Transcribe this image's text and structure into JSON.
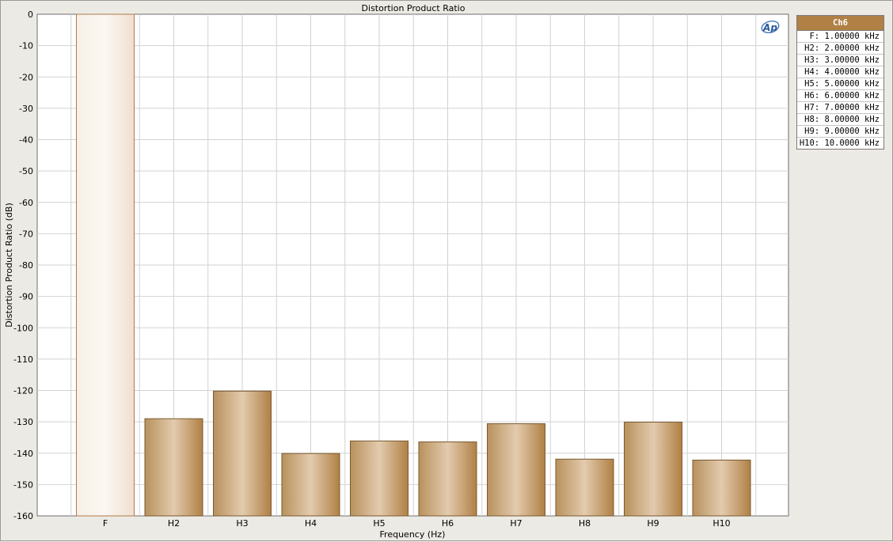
{
  "chart_data": {
    "type": "bar",
    "title": "Distortion Product Ratio",
    "xlabel": "Frequency (Hz)",
    "ylabel": "Distortion Product Ratio (dB)",
    "ylim": [
      -160,
      0
    ],
    "yticks": [
      0,
      -10,
      -20,
      -30,
      -40,
      -50,
      -60,
      -70,
      -80,
      -90,
      -100,
      -110,
      -120,
      -130,
      -140,
      -150,
      -160
    ],
    "categories": [
      "F",
      "H2",
      "H3",
      "H4",
      "H5",
      "H6",
      "H7",
      "H8",
      "H9",
      "H10"
    ],
    "series": [
      {
        "name": "Ch6",
        "values": [
          0,
          -129,
          -120.2,
          -140.1,
          -136.1,
          -136.4,
          -130.6,
          -141.9,
          -130.1,
          -142.2
        ]
      }
    ],
    "grid": true,
    "legend_position": "right",
    "bar_color": "#b08045",
    "fundamental_bar_color": "#f3e8dc"
  },
  "legend": {
    "title": "Ch6",
    "items": [
      "F: 1.00000 kHz",
      "H2: 2.00000 kHz",
      "H3: 3.00000 kHz",
      "H4: 4.00000 kHz",
      "H5: 5.00000 kHz",
      "H6: 6.00000 kHz",
      "H7: 7.00000 kHz",
      "H8: 8.00000 kHz",
      "H9: 9.00000 kHz",
      "H10: 10.0000 kHz"
    ]
  },
  "logo": "Ap"
}
